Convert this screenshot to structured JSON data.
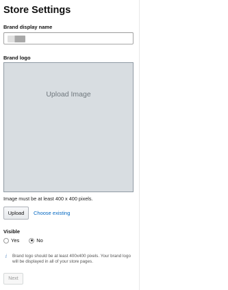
{
  "page": {
    "title": "Store Settings"
  },
  "brand_name": {
    "label": "Brand display name",
    "value": ""
  },
  "brand_logo": {
    "label": "Brand logo",
    "upload_area_text": "Upload Image",
    "requirement": "Image must be at least 400 x 400 pixels.",
    "upload_button": "Upload",
    "choose_existing_link": "Choose existing"
  },
  "visibility": {
    "label": "Visible",
    "options": [
      {
        "label": "Yes",
        "selected": false
      },
      {
        "label": "No",
        "selected": true
      }
    ]
  },
  "info": {
    "icon": "info-icon",
    "text": "Brand logo should be at least 400x400 pixels. Your brand logo will be displayed in all of your store pages."
  },
  "footer": {
    "next_button": "Next",
    "next_disabled": true
  }
}
